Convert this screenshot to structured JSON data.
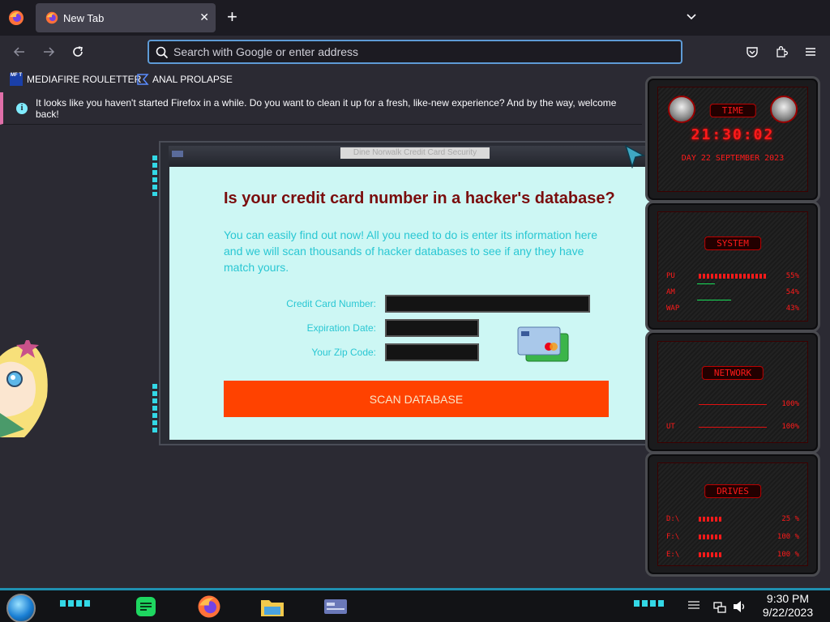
{
  "browser": {
    "tab_title": "New Tab",
    "url_placeholder": "Search with Google or enter address",
    "bookmarks": [
      {
        "label": "MEDIAFIRE ROULETTER",
        "icon_text": "MF T"
      },
      {
        "label": "ANAL PROLAPSE"
      }
    ],
    "notice": "It looks like you haven't started Firefox in a while. Do you want to clean it up for a fresh, like-new experience? And by the way, welcome back!"
  },
  "scam": {
    "window_title": "Dine Norwalk Credit Card Security",
    "heading": "Is your credit card number in a hacker's database?",
    "description": "You can easily find out now! All you need to do is enter its information here and we will scan thousands of hacker databases to see if any they have match yours.",
    "labels": {
      "card_number": "Credit Card Number:",
      "expiration": "Expiration Date:",
      "zip": "Your Zip Code:"
    },
    "button": "SCAN DATABASE"
  },
  "gadgets": {
    "time_title": "TIME",
    "time": "21:30:02",
    "date": "DAY 22 SEPTEMBER 2023",
    "system_title": "SYSTEM",
    "system_rows": [
      {
        "label": "PU",
        "value": "55%"
      },
      {
        "label": "AM",
        "value": "54%"
      },
      {
        "label": "WAP",
        "value": "43%"
      }
    ],
    "network_title": "NETWORK",
    "network_rows": [
      {
        "label": "",
        "value": "100%"
      },
      {
        "label": "UT",
        "value": "100%"
      }
    ],
    "drives_title": "DRIVES",
    "drives_rows": [
      {
        "label": "D:\\",
        "value": "25 %"
      },
      {
        "label": "F:\\",
        "value": "100 %"
      },
      {
        "label": "E:\\",
        "value": "100 %"
      }
    ]
  },
  "taskbar": {
    "time": "9:30 PM",
    "date": "9/22/2023"
  },
  "colors": {
    "accent_cyan": "#33d8e6",
    "scam_button": "#ff4200",
    "gadget_red": "#ff1a1a",
    "heading_red": "#7a0d0d"
  }
}
